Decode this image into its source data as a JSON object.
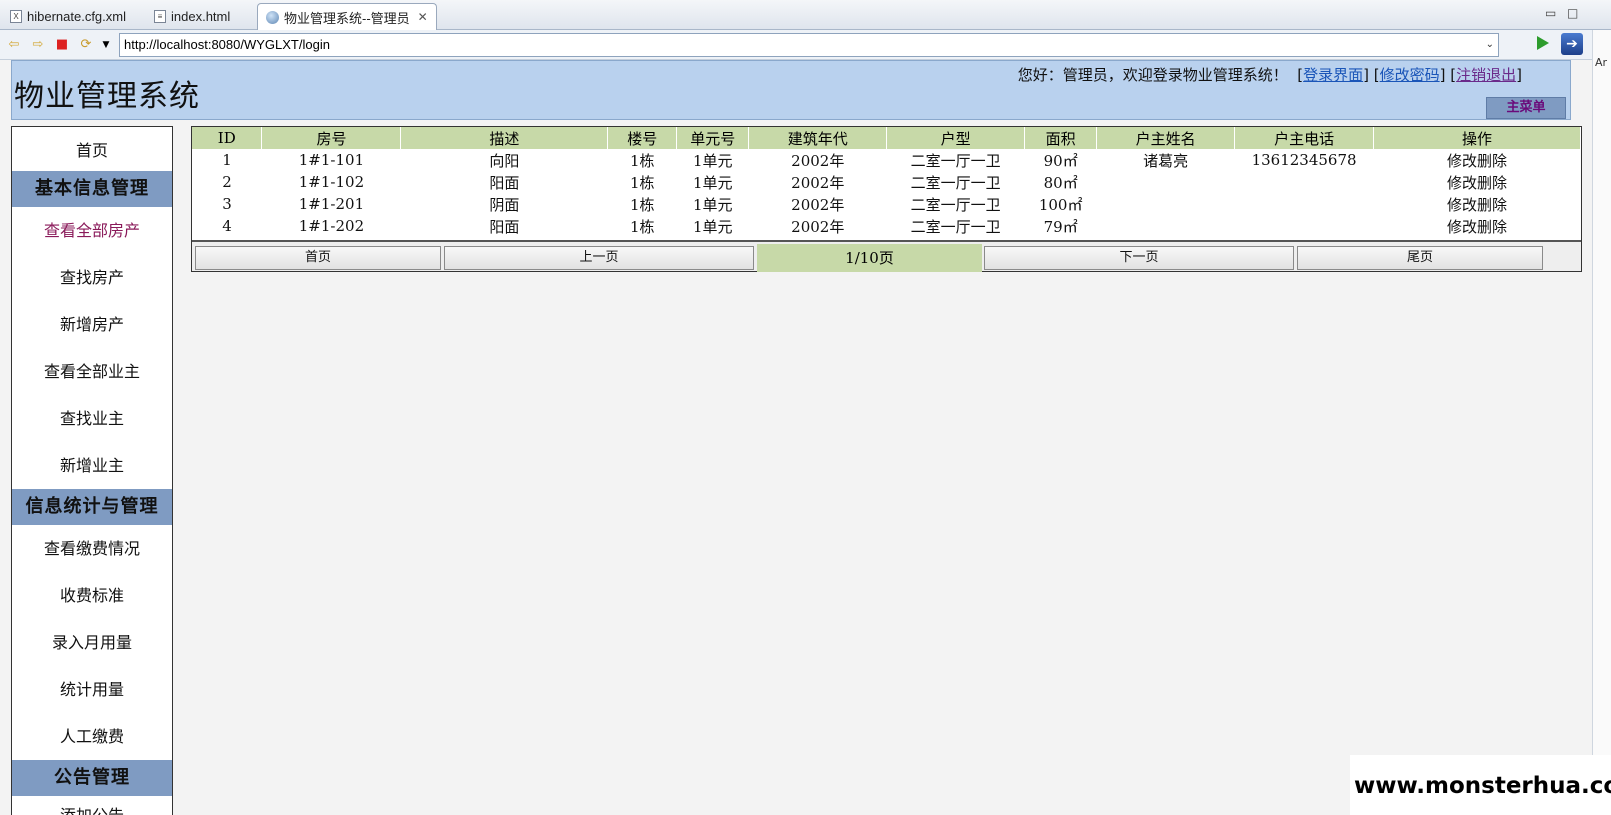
{
  "tabs": [
    {
      "label": "hibernate.cfg.xml",
      "icon": "xml-file-icon"
    },
    {
      "label": "index.html",
      "icon": "html-file-icon"
    },
    {
      "label": "物业管理系统--管理员",
      "icon": "globe-icon"
    }
  ],
  "browser": {
    "url": "http://localhost:8080/WYGLXT/login"
  },
  "right_strip_text": "Ar",
  "header": {
    "title": "物业管理系统",
    "welcome": "您好：管理员，欢迎登录物业管理系统！",
    "links": [
      "登录界面",
      "修改密码",
      "注销退出"
    ],
    "main_menu": "主菜单"
  },
  "sidebar": {
    "home": "首页",
    "groups": [
      {
        "title": "基本信息管理",
        "items": [
          "查看全部房产",
          "查找房产",
          "新增房产",
          "查看全部业主",
          "查找业主",
          "新增业主"
        ]
      },
      {
        "title": "信息统计与管理",
        "items": [
          "查看缴费情况",
          "收费标准",
          "录入月用量",
          "统计用量",
          "人工缴费"
        ]
      },
      {
        "title": "公告管理",
        "items": [
          "添加公告"
        ]
      }
    ]
  },
  "table": {
    "headers": [
      "ID",
      "房号",
      "描述",
      "楼号",
      "单元号",
      "建筑年代",
      "户型",
      "面积",
      "户主姓名",
      "户主电话",
      "操作"
    ],
    "rows": [
      [
        "1",
        "1#1-101",
        "向阳",
        "1栋",
        "1单元",
        "2002年",
        "二室一厅一卫",
        "90㎡",
        "诸葛亮",
        "13612345678"
      ],
      [
        "2",
        "1#1-102",
        "阳面",
        "1栋",
        "1单元",
        "2002年",
        "二室一厅一卫",
        "80㎡",
        "",
        ""
      ],
      [
        "3",
        "1#1-201",
        "阴面",
        "1栋",
        "1单元",
        "2002年",
        "二室一厅一卫",
        "100㎡",
        "",
        ""
      ],
      [
        "4",
        "1#1-202",
        "阳面",
        "1栋",
        "1单元",
        "2002年",
        "二室一厅一卫",
        "79㎡",
        "",
        ""
      ]
    ],
    "edit_label": "修改",
    "delete_label": "删除"
  },
  "pager": {
    "first": "首页",
    "prev": "上一页",
    "info": "1/10页",
    "next": "下一页",
    "last": "尾页"
  },
  "watermark": "www.monsterhua.com"
}
